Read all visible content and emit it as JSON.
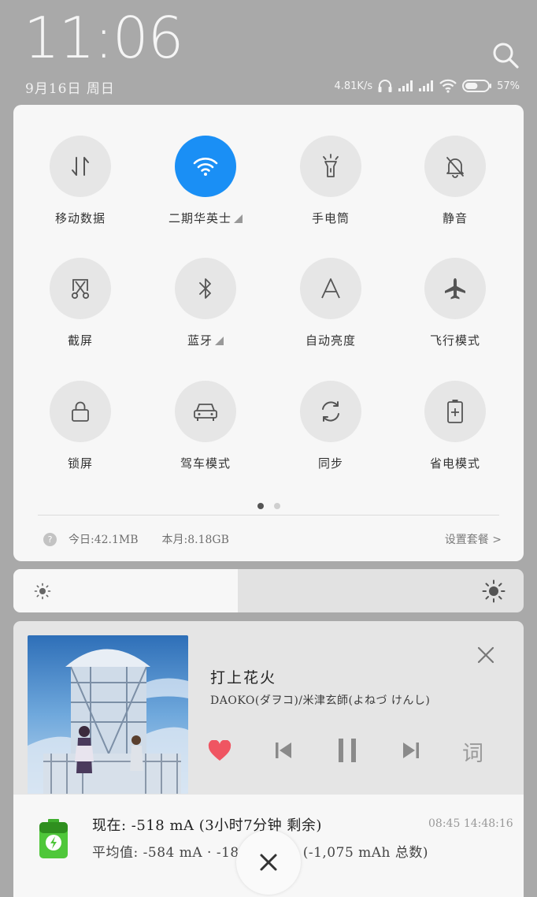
{
  "status_bar": {
    "time": "11:06",
    "date": "9月16日 周日",
    "network_speed": "4.81K/s",
    "battery_percent": "57%",
    "battery_level": 0.57
  },
  "quick_settings": {
    "tiles": [
      {
        "label": "移动数据",
        "icon": "data-arrows-icon",
        "active": false
      },
      {
        "label": "二期华英士",
        "icon": "wifi-icon",
        "active": true,
        "has_menu": true
      },
      {
        "label": "手电筒",
        "icon": "flashlight-icon",
        "active": false
      },
      {
        "label": "静音",
        "icon": "bell-off-icon",
        "active": false
      },
      {
        "label": "截屏",
        "icon": "screenshot-scissors-icon",
        "active": false
      },
      {
        "label": "蓝牙",
        "icon": "bluetooth-icon",
        "active": false,
        "has_menu": true
      },
      {
        "label": "自动亮度",
        "icon": "auto-brightness-icon",
        "active": false
      },
      {
        "label": "飞行模式",
        "icon": "airplane-icon",
        "active": false
      },
      {
        "label": "锁屏",
        "icon": "lock-icon",
        "active": false
      },
      {
        "label": "驾车模式",
        "icon": "car-icon",
        "active": false
      },
      {
        "label": "同步",
        "icon": "sync-icon",
        "active": false
      },
      {
        "label": "省电模式",
        "icon": "battery-saver-icon",
        "active": false
      }
    ],
    "page_count": 2,
    "current_page": 1,
    "data_usage": {
      "help_glyph": "?",
      "today": "今日:42.1MB",
      "month": "本月:8.18GB",
      "plan_link": "设置套餐 >"
    }
  },
  "brightness": {
    "level": 0.44
  },
  "music": {
    "title": "打上花火",
    "artist": "DAOKO(ダヲコ)/米津玄師(よねづ けんし)",
    "liked": true,
    "lyrics_label": "词"
  },
  "battery_notification": {
    "line1": "现在: -518 mA (3小时7分钟 剩余)",
    "line2": "平均值: -584 mA · -18.3%/小时 (-1,075 mAh 总数)",
    "start_time": "08:45",
    "current_time": "14:48:16"
  },
  "colors": {
    "accent": "#1a8ff5",
    "heart": "#ef5562",
    "battery_green": "#4fc73a"
  }
}
